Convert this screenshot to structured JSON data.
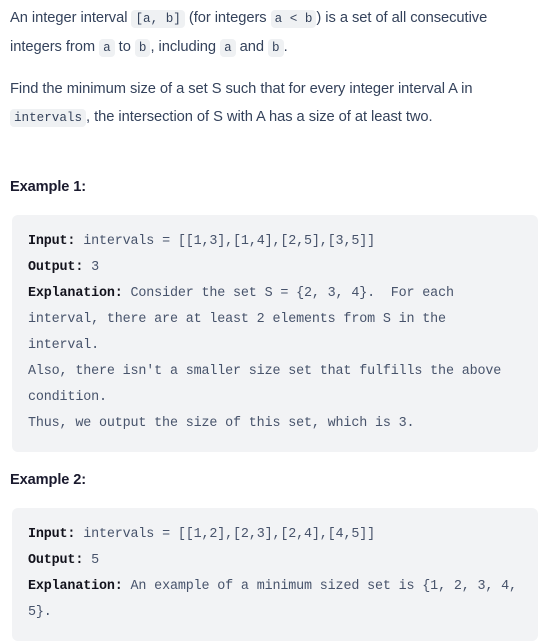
{
  "description": {
    "paragraph1": {
      "seg1": "An integer interval ",
      "code1": "[a, b]",
      "seg2": " (for integers ",
      "code2": "a < b",
      "seg3": ") is a set of all consecutive integers from ",
      "code3": "a",
      "seg4": " to ",
      "code4": "b",
      "seg5": ", including ",
      "code5": "a",
      "seg6": " and ",
      "code6": "b",
      "seg7": "."
    },
    "paragraph2": {
      "seg1": "Find the minimum size of a set S such that for every integer interval A in ",
      "code1": "intervals",
      "seg2": ", the intersection of S with A has a size of at least two."
    }
  },
  "examples": [
    {
      "title": "Example 1:",
      "input_label": "Input:",
      "input_value": " intervals = [[1,3],[1,4],[2,5],[3,5]]",
      "output_label": "Output:",
      "output_value": " 3",
      "explanation_label": "Explanation:",
      "explanation_value": " Consider the set S = {2, 3, 4}.  For each interval, there are at least 2 elements from S in the interval.",
      "extra_lines": [
        "Also, there isn't a smaller size set that fulfills the above condition.",
        "Thus, we output the size of this set, which is 3."
      ]
    },
    {
      "title": "Example 2:",
      "input_label": "Input:",
      "input_value": " intervals = [[1,2],[2,3],[2,4],[4,5]]",
      "output_label": "Output:",
      "output_value": " 5",
      "explanation_label": "Explanation:",
      "explanation_value": " An example of a minimum sized set is {1, 2, 3, 4, 5}.",
      "extra_lines": []
    }
  ],
  "colors": {
    "body_text": "#34425b",
    "heading": "#1a1a2e",
    "code_background": "#f2f3f5",
    "inline_code_background": "#eff1f3",
    "code_text": "#47536b",
    "code_bold": "#12121c",
    "page_background": "#ffffff"
  }
}
